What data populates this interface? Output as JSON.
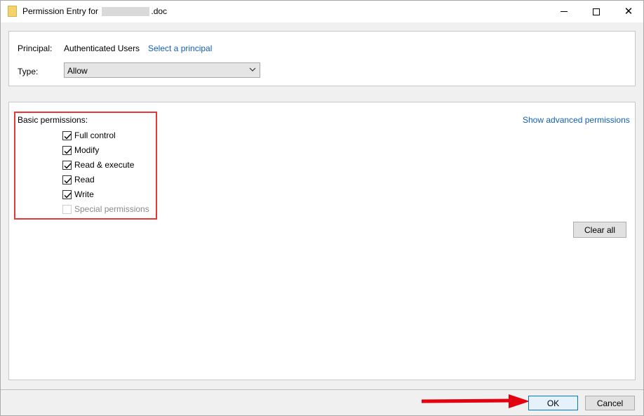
{
  "window": {
    "title_prefix": "Permission Entry for",
    "title_suffix": ".doc"
  },
  "principal": {
    "label": "Principal:",
    "value": "Authenticated Users",
    "link": "Select a principal"
  },
  "type": {
    "label": "Type:",
    "selected": "Allow"
  },
  "permissions": {
    "heading": "Basic permissions:",
    "show_advanced": "Show advanced permissions",
    "items": [
      {
        "label": "Full control",
        "checked": true,
        "enabled": true
      },
      {
        "label": "Modify",
        "checked": true,
        "enabled": true
      },
      {
        "label": "Read & execute",
        "checked": true,
        "enabled": true
      },
      {
        "label": "Read",
        "checked": true,
        "enabled": true
      },
      {
        "label": "Write",
        "checked": true,
        "enabled": true
      },
      {
        "label": "Special permissions",
        "checked": false,
        "enabled": false
      }
    ],
    "clear_all": "Clear all"
  },
  "footer": {
    "ok": "OK",
    "cancel": "Cancel"
  },
  "colors": {
    "link": "#0f5fb5",
    "highlight": "#e53935",
    "ok_border": "#0078d7"
  }
}
